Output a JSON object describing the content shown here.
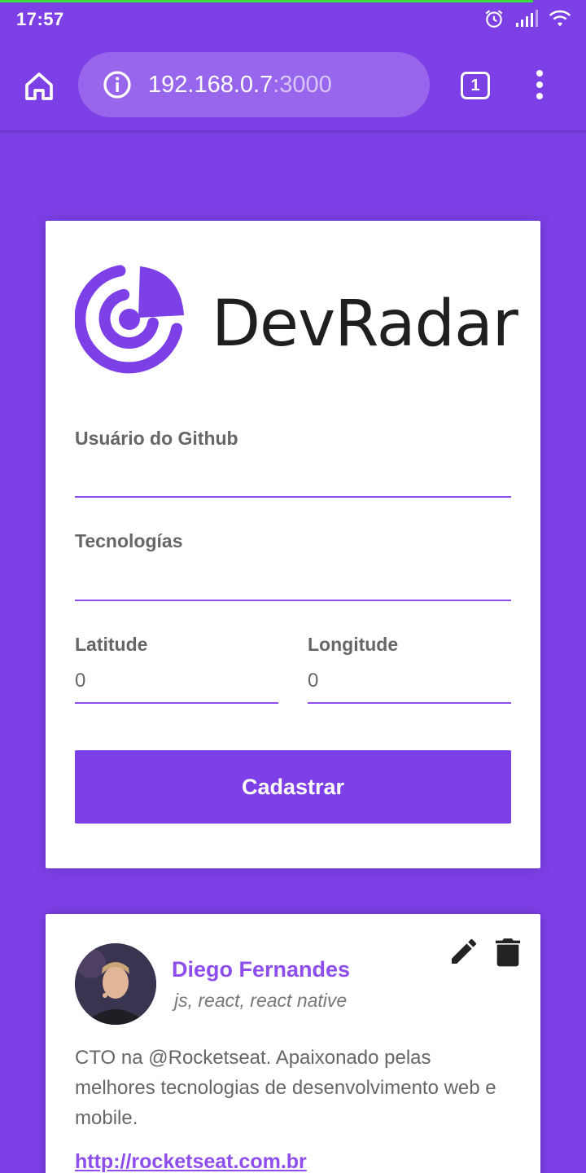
{
  "status_bar": {
    "time": "17:57"
  },
  "browser": {
    "url_host": "192.168.0.7",
    "url_port": ":3000",
    "tab_count": "1"
  },
  "form": {
    "brand": "DevRadar",
    "github_user_label": "Usuário do Github",
    "github_user_value": "",
    "techs_label": "Tecnologías",
    "techs_value": "",
    "latitude_label": "Latitude",
    "latitude_value": "0",
    "longitude_label": "Longitude",
    "longitude_value": "0",
    "submit_label": "Cadastrar"
  },
  "devs": [
    {
      "name": "Diego Fernandes",
      "techs": "js, react, react native",
      "bio": "CTO na @Rocketseat. Apaixonado pelas melhores tecnologias de desenvolvimento web e mobile.",
      "link": "http://rocketseat.com.br"
    }
  ],
  "colors": {
    "accent": "#7d40e7",
    "accent_light": "#8e4ded",
    "card": "#ffffff"
  }
}
